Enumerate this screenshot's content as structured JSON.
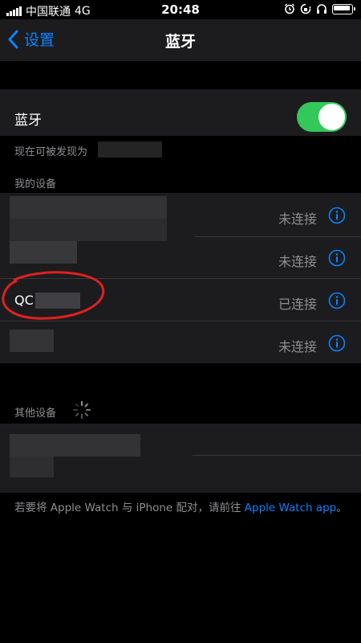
{
  "status_bar": {
    "carrier": "中国联通",
    "network": "4G",
    "time": "20:48",
    "icons": [
      "alarm-icon",
      "orientation-lock-icon",
      "headphones-icon",
      "battery-icon"
    ]
  },
  "nav": {
    "back_label": "设置",
    "title": "蓝牙"
  },
  "bluetooth": {
    "label": "蓝牙",
    "enabled": true,
    "discoverable_text": "现在可被发现为"
  },
  "my_devices": {
    "header": "我的设备",
    "devices": [
      {
        "name": "",
        "status": "未连接"
      },
      {
        "name": "",
        "status": "未连接"
      },
      {
        "name": "QC",
        "status": "已连接"
      },
      {
        "name": "",
        "status": "未连接"
      }
    ]
  },
  "other_devices": {
    "header": "其他设备"
  },
  "footer": {
    "prefix": "若要将 Apple Watch 与 iPhone 配对，请前往",
    "link": "Apple Watch app",
    "suffix": "。"
  },
  "colors": {
    "accent": "#0a84ff",
    "toggle_on": "#34c759",
    "cell_bg": "#1c1c1e",
    "annotation": "#e02020"
  }
}
